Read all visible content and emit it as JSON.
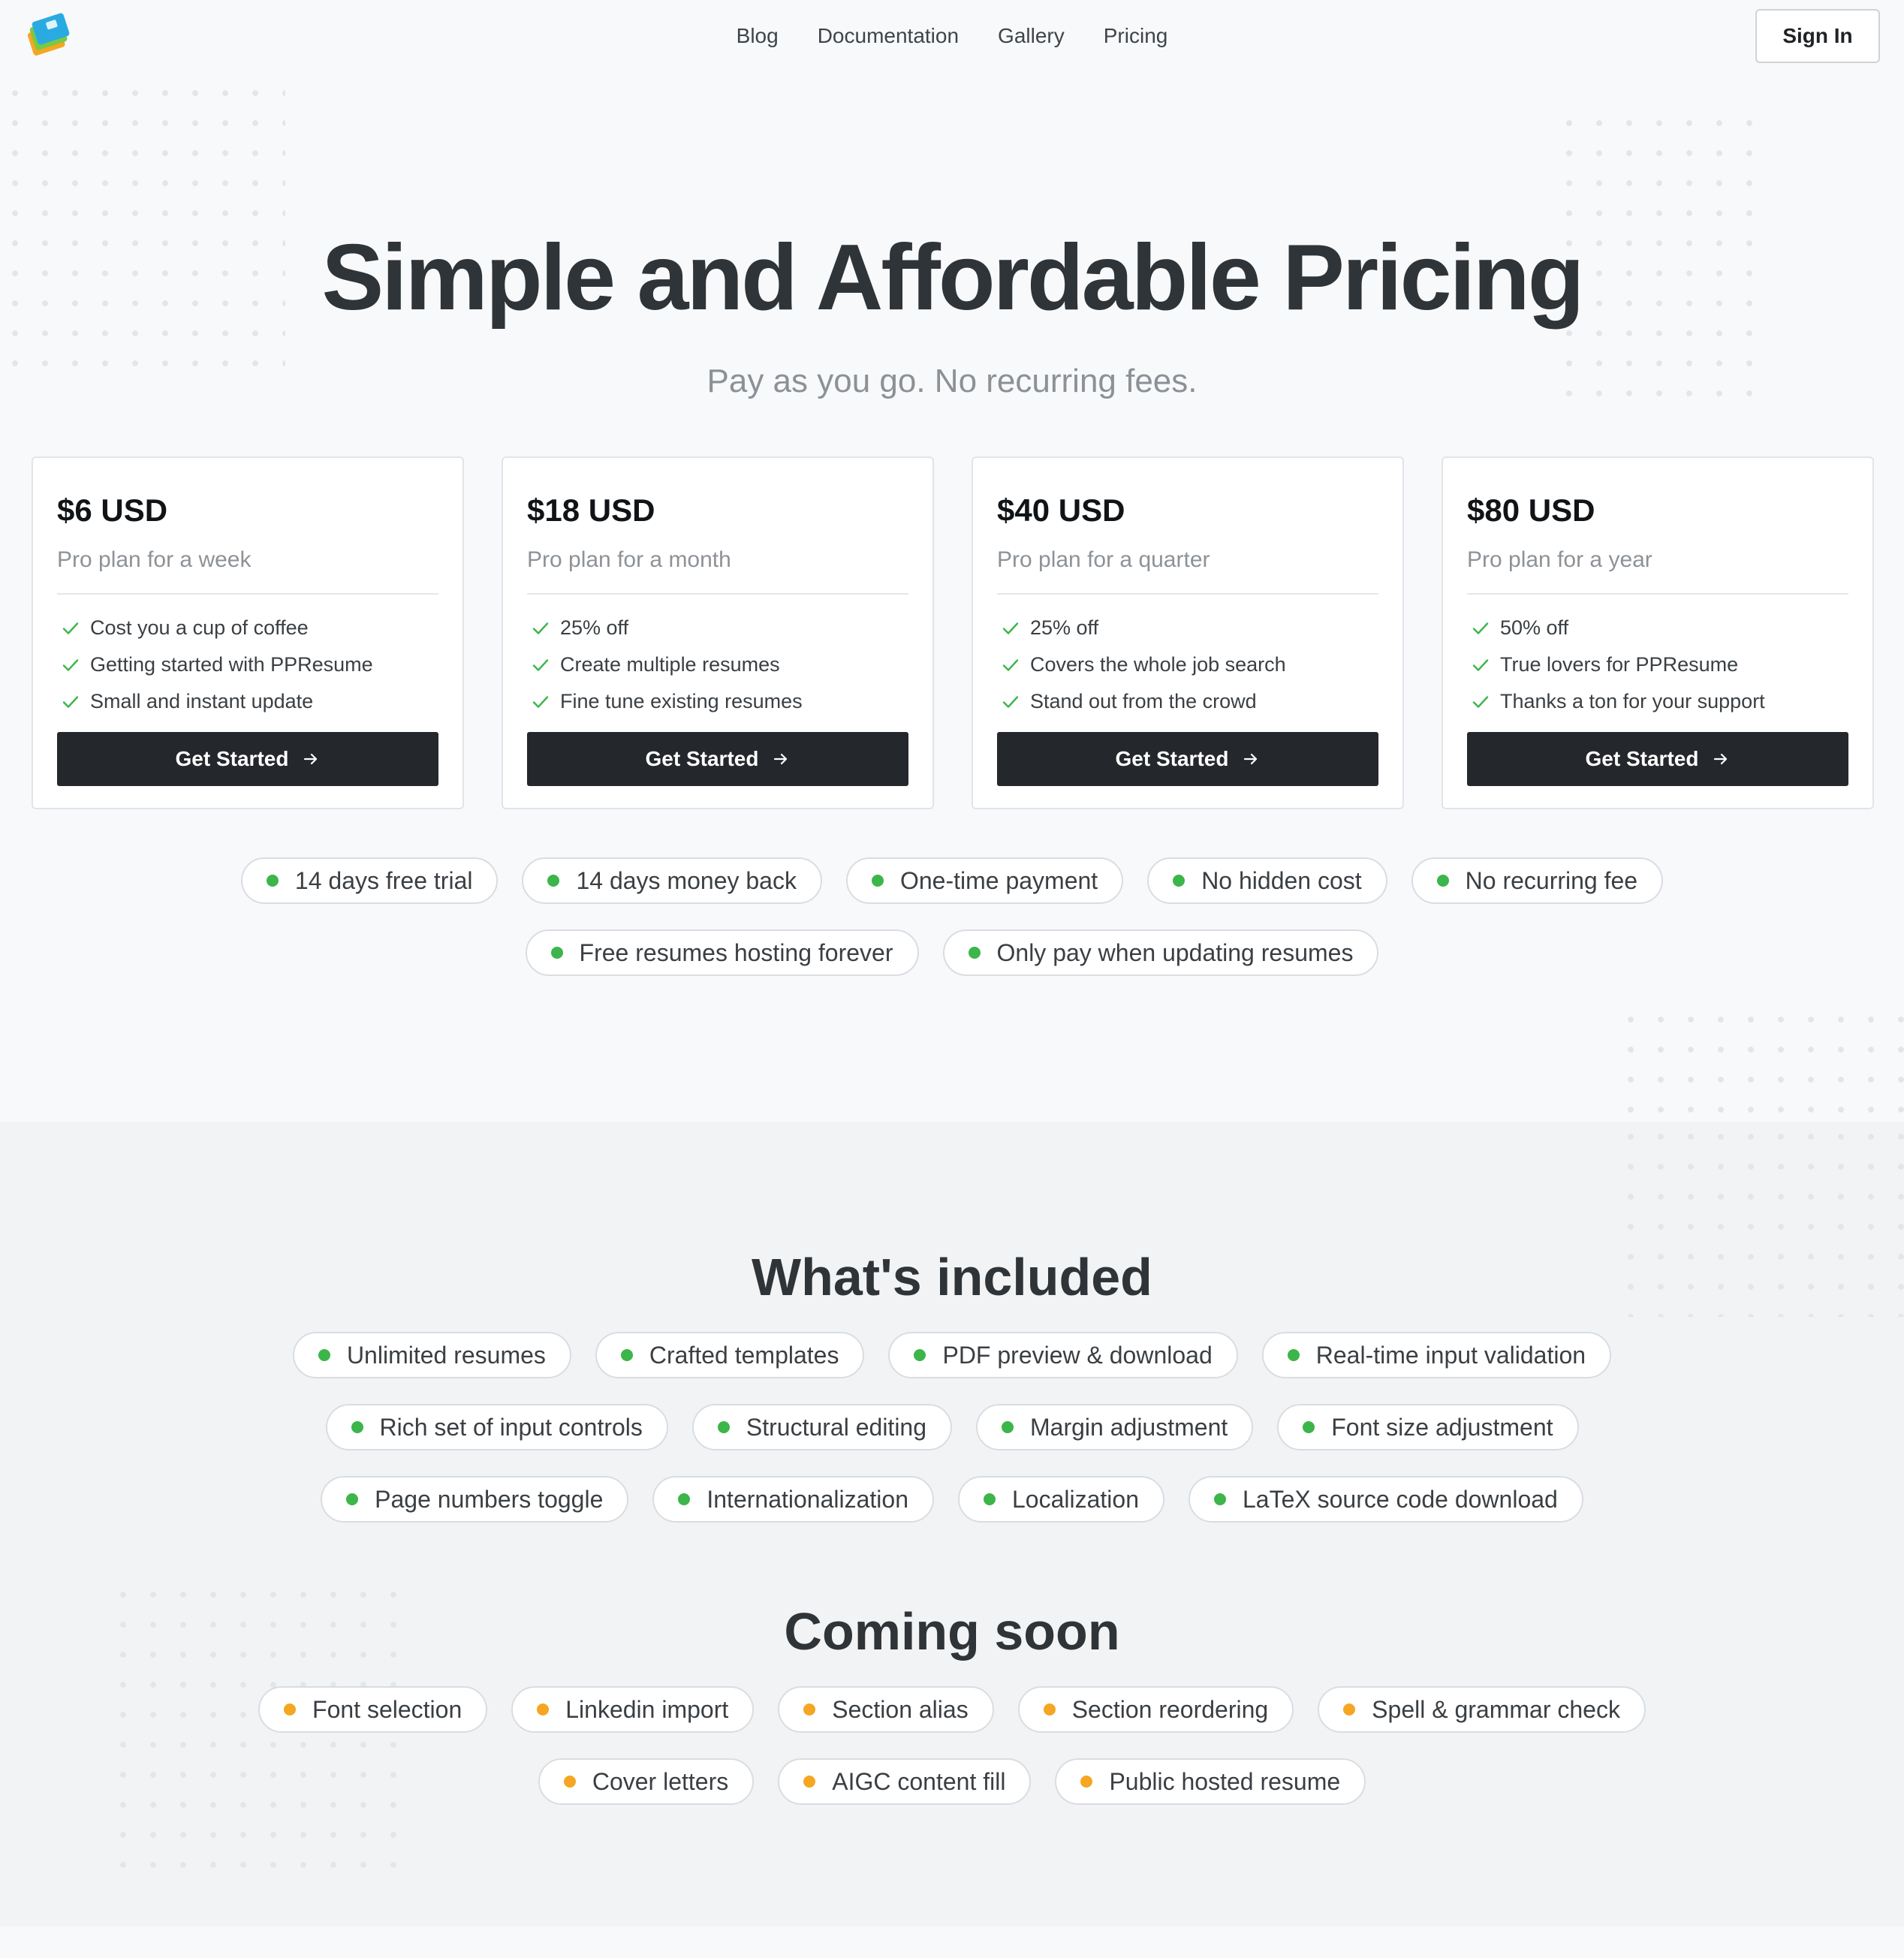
{
  "header": {
    "logo_icon": "stacked-cards-logo-icon",
    "nav": [
      "Blog",
      "Documentation",
      "Gallery",
      "Pricing"
    ],
    "signin_label": "Sign In"
  },
  "hero": {
    "title": "Simple and Affordable Pricing",
    "subtitle": "Pay as you go. No recurring fees."
  },
  "plans": [
    {
      "price": "$6 USD",
      "desc": "Pro plan for a week",
      "features": [
        "Cost you a cup of coffee",
        "Getting started with PPResume",
        "Small and instant update"
      ],
      "cta": "Get Started"
    },
    {
      "price": "$18 USD",
      "desc": "Pro plan for a month",
      "features": [
        "25% off",
        "Create multiple resumes",
        "Fine tune existing resumes"
      ],
      "cta": "Get Started"
    },
    {
      "price": "$40 USD",
      "desc": "Pro plan for a quarter",
      "features": [
        "25% off",
        "Covers the whole job search",
        "Stand out from the crowd"
      ],
      "cta": "Get Started"
    },
    {
      "price": "$80 USD",
      "desc": "Pro plan for a year",
      "features": [
        "50% off",
        "True lovers for PPResume",
        "Thanks a ton for your support"
      ],
      "cta": "Get Started"
    }
  ],
  "benefits": {
    "row1": [
      "14 days free trial",
      "14 days money back",
      "One-time payment",
      "No hidden cost",
      "No recurring fee"
    ],
    "row2": [
      "Free resumes hosting forever",
      "Only pay when updating resumes"
    ]
  },
  "included": {
    "title": "What's included",
    "row1": [
      "Unlimited resumes",
      "Crafted templates",
      "PDF preview & download",
      "Real-time input validation"
    ],
    "row2": [
      "Rich set of input controls",
      "Structural editing",
      "Margin adjustment",
      "Font size adjustment"
    ],
    "row3": [
      "Page numbers toggle",
      "Internationalization",
      "Localization",
      "LaTeX source code download"
    ]
  },
  "coming_soon": {
    "title": "Coming soon",
    "row1": [
      "Font selection",
      "Linkedin import",
      "Section alias",
      "Section reordering",
      "Spell & grammar check"
    ],
    "row2": [
      "Cover letters",
      "AIGC content fill",
      "Public hosted resume"
    ]
  },
  "colors": {
    "available_dot": "#3cb54a",
    "coming_dot": "#f5a623",
    "check": "#3cb54a",
    "button_dark": "#24272b"
  },
  "icons": {
    "check": "check-icon",
    "arrow": "arrow-right-icon",
    "pill_dot": "status-dot-icon"
  }
}
